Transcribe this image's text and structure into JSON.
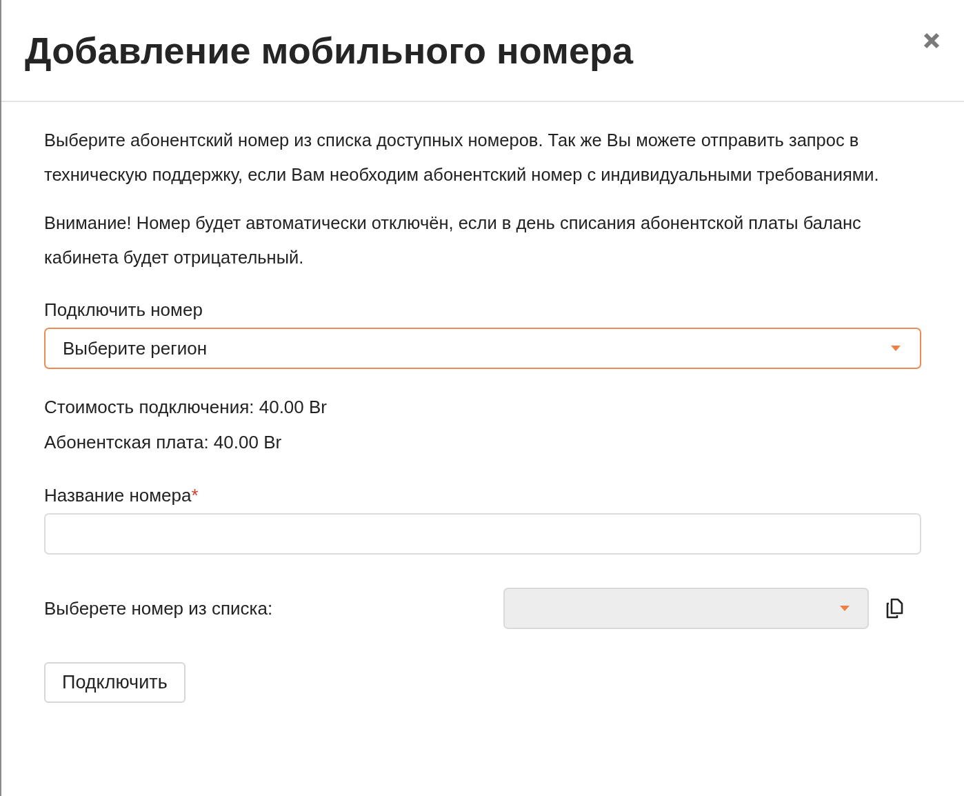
{
  "dialog": {
    "title": "Добавление мобильного номера"
  },
  "paragraphs": [
    "Выберите абонентский номер из списка доступных номеров. Так же Вы можете отправить запрос в техническую поддержку, если Вам необходим абонентский номер с индивидуальными требованиями.",
    "Внимание! Номер будет автоматически отключён, если в день списания абонентской платы баланс кабинета будет отрицательный."
  ],
  "region_select": {
    "label": "Подключить номер",
    "value": "Выберите регион",
    "focused": true
  },
  "prices": [
    "Стоимость подключения: 40.00 Br",
    "Абонентская плата: 40.00 Br"
  ],
  "name_field": {
    "label": "Название номера",
    "required_mark": "*",
    "required": true
  },
  "number_select": {
    "label": "Выберете номер из списка:",
    "disabled": true
  },
  "buttons": [
    {
      "label": "Подключить"
    }
  ]
}
